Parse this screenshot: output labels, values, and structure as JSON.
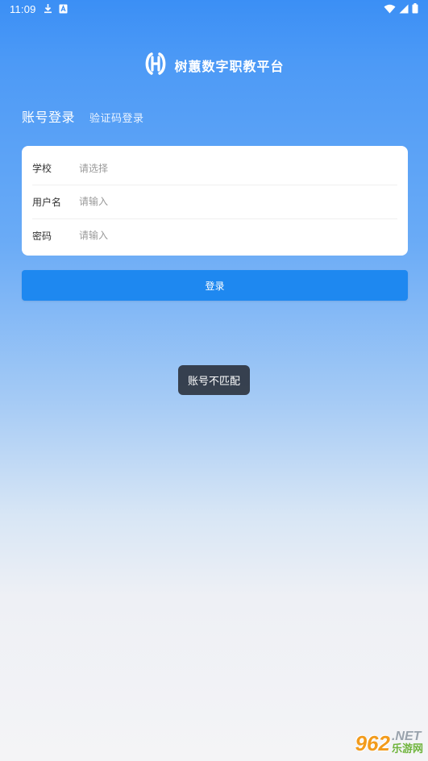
{
  "status_bar": {
    "time": "11:09",
    "left_icons": [
      "download-icon",
      "notification-a-icon"
    ],
    "right_icons": [
      "wifi-icon",
      "signal-icon",
      "battery-icon"
    ]
  },
  "brand": {
    "logo_icon": "h-logo-icon",
    "name": "树蕙数字职教平台"
  },
  "tabs": {
    "account_login": "账号登录",
    "code_login": "验证码登录"
  },
  "form": {
    "school": {
      "label": "学校",
      "placeholder": "请选择"
    },
    "username": {
      "label": "用户名",
      "placeholder": "请输入",
      "value": ""
    },
    "password": {
      "label": "密码",
      "placeholder": "请输入",
      "value": ""
    }
  },
  "login_button": "登录",
  "toast": "账号不匹配",
  "watermark": {
    "number": "962",
    "net": ".NET",
    "site": "乐游网"
  },
  "colors": {
    "primary": "#1e88f0",
    "header_gradient_top": "#3b8ff5",
    "background_bottom": "#f4f4f6",
    "toast_bg": "#2c323b"
  }
}
